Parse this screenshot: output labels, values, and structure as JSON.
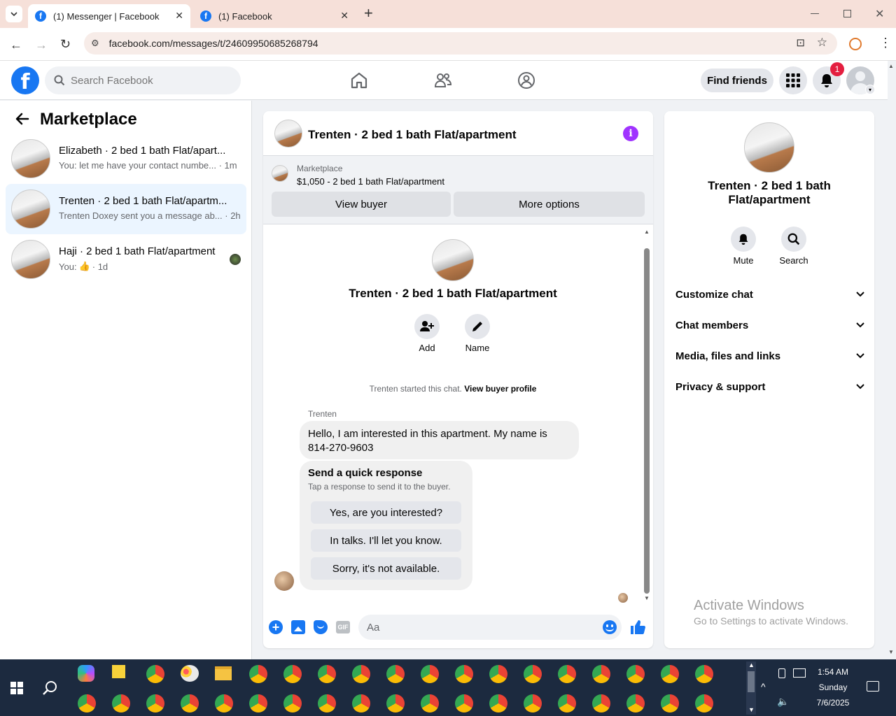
{
  "browser": {
    "tabs": [
      {
        "label": "(1) Messenger | Facebook",
        "active": true
      },
      {
        "label": "(1) Facebook",
        "active": false
      }
    ],
    "url": "facebook.com/messages/t/24609950685268794"
  },
  "header": {
    "search_placeholder": "Search Facebook",
    "find_friends": "Find friends",
    "notif_count": "1"
  },
  "left": {
    "title": "Marketplace",
    "conversations": [
      {
        "title": "Elizabeth · 2 bed 1 bath Flat/apart...",
        "preview": "You: let me have your contact numbe... · 1m"
      },
      {
        "title": "Trenten · 2 bed 1 bath Flat/apartm...",
        "preview": "Trenten Doxey sent you a message ab... · 2h"
      },
      {
        "title": "Haji · 2 bed 1 bath Flat/apartment",
        "preview_prefix": "You:",
        "preview_suffix": "· 1d"
      }
    ]
  },
  "chat": {
    "title": "Trenten · 2 bed 1 bath Flat/apartment",
    "listing_source": "Marketplace",
    "listing_price": "$1,050 - 2 bed 1 bath Flat/apartment",
    "view_buyer": "View buyer",
    "more_options": "More options",
    "profile_name": "Trenten · 2 bed 1 bath Flat/apartment",
    "add_label": "Add",
    "name_label": "Name",
    "started_text": "Trenten started this chat.",
    "view_profile": "View buyer profile",
    "sender": "Trenten",
    "message": "Hello, I am interested in this apartment. My name is 814-270-9603",
    "quick_title": "Send a quick response",
    "quick_sub": "Tap a response to send it to the buyer.",
    "quick_responses": [
      "Yes, are you interested?",
      "In talks. I'll let you know.",
      "Sorry, it's not available."
    ],
    "composer_placeholder": "Aa"
  },
  "details": {
    "title": "Trenten · 2 bed 1 bath Flat/apartment",
    "mute": "Mute",
    "search": "Search",
    "sections": [
      "Customize chat",
      "Chat members",
      "Media, files and links",
      "Privacy & support"
    ]
  },
  "watermark": {
    "line1": "Activate Windows",
    "line2": "Go to Settings to activate Windows."
  },
  "taskbar": {
    "time": "1:54 AM",
    "day": "Sunday",
    "date": "7/6/2025"
  },
  "colors": {
    "fb_blue": "#1877f2",
    "purple": "#a033ff",
    "selected_bg": "#ebf5ff",
    "taskbar": "#1c2a3f"
  }
}
